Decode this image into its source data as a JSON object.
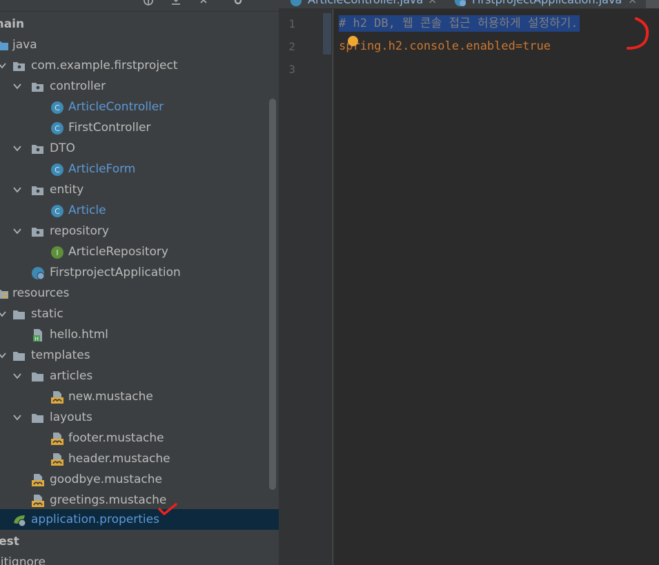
{
  "tree": {
    "items": [
      {
        "label": "main",
        "icon": "folder-icon"
      },
      {
        "label": "java",
        "icon": "source-folder-icon"
      },
      {
        "label": "com.example.firstproject",
        "icon": "package-icon"
      },
      {
        "label": "controller",
        "icon": "package-icon"
      },
      {
        "label": "ArticleController",
        "icon": "class-icon"
      },
      {
        "label": "FirstController",
        "icon": "class-icon"
      },
      {
        "label": "DTO",
        "icon": "package-icon"
      },
      {
        "label": "ArticleForm",
        "icon": "class-icon"
      },
      {
        "label": "entity",
        "icon": "package-icon"
      },
      {
        "label": "Article",
        "icon": "class-icon"
      },
      {
        "label": "repository",
        "icon": "package-icon"
      },
      {
        "label": "ArticleRepository",
        "icon": "interface-icon"
      },
      {
        "label": "FirstprojectApplication",
        "icon": "spring-boot-class-icon"
      },
      {
        "label": "resources",
        "icon": "resources-folder-icon"
      },
      {
        "label": "static",
        "icon": "folder-icon"
      },
      {
        "label": "hello.html",
        "icon": "html-file-icon"
      },
      {
        "label": "templates",
        "icon": "folder-icon"
      },
      {
        "label": "articles",
        "icon": "folder-icon"
      },
      {
        "label": "new.mustache",
        "icon": "mustache-file-icon"
      },
      {
        "label": "layouts",
        "icon": "folder-icon"
      },
      {
        "label": "footer.mustache",
        "icon": "mustache-file-icon"
      },
      {
        "label": "header.mustache",
        "icon": "mustache-file-icon"
      },
      {
        "label": "goodbye.mustache",
        "icon": "mustache-file-icon"
      },
      {
        "label": "greetings.mustache",
        "icon": "mustache-file-icon"
      },
      {
        "label": "application.properties",
        "icon": "spring-properties-icon"
      },
      {
        "label": "test",
        "icon": "folder-icon"
      },
      {
        "label": "gitignore",
        "icon": "file-icon"
      }
    ]
  },
  "tabs": [
    {
      "label": "ArticleController.java",
      "icon": "class-icon"
    },
    {
      "label": "FirstprojectApplication.java",
      "icon": "spring-boot-class-icon"
    }
  ],
  "editor": {
    "line_numbers": [
      "1",
      "2",
      "3"
    ],
    "lines": [
      "# h2 DB, 웹 콘솔 접근 허용하게 설정하기.",
      "spring.h2.console.enabled=true",
      ""
    ]
  },
  "colors": {
    "selection": "#214283",
    "comment": "#808080",
    "property_key": "#cc7832",
    "tree_text": "#bbbbbb",
    "class_link": "#5c99d6",
    "selected_row": "#0d293e",
    "annotation": "#e8231f"
  }
}
